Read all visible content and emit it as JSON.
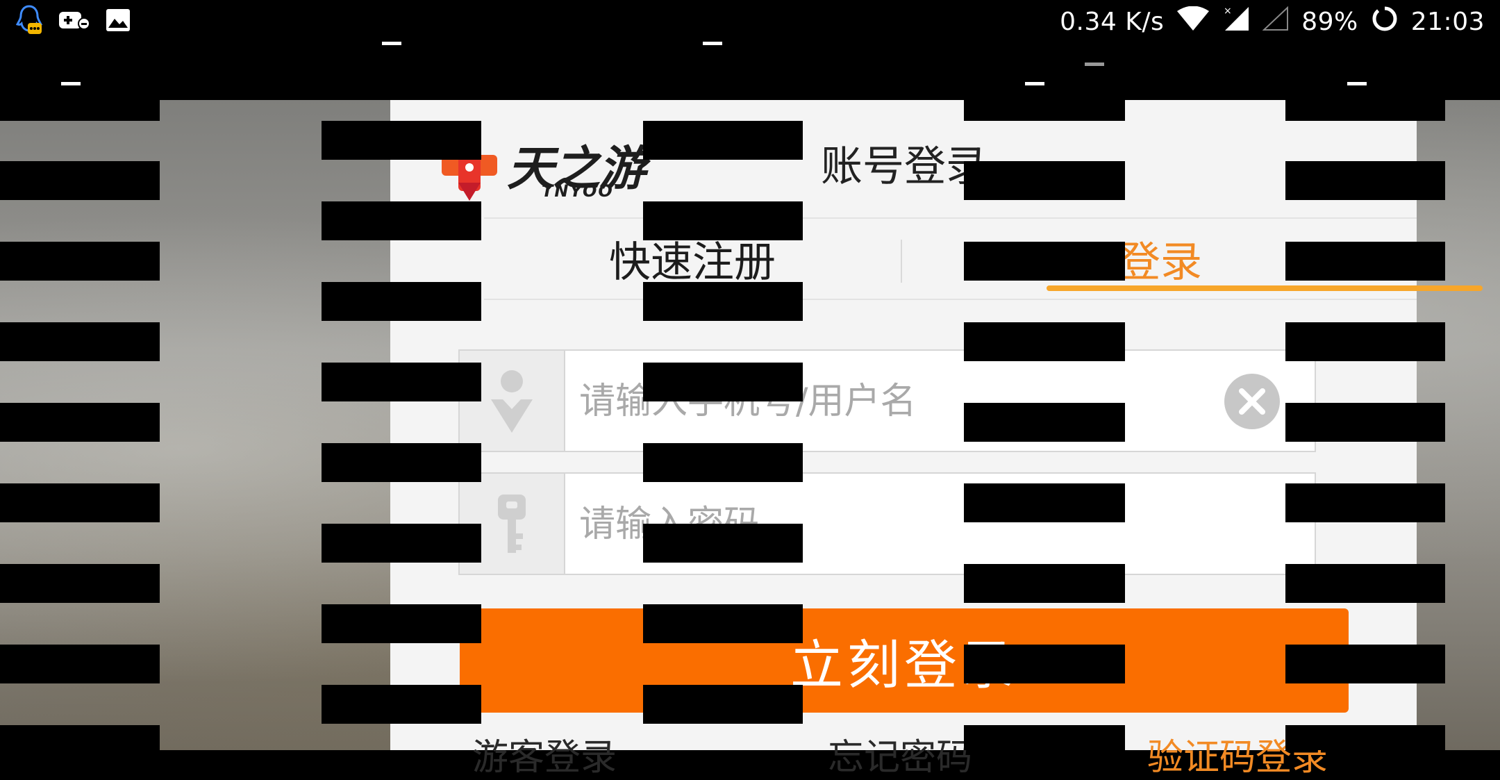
{
  "status_bar": {
    "network_speed": "0.34 K/s",
    "battery": "89%",
    "time": "21:03",
    "left_icons": [
      "qq-icon",
      "game-controller-icon",
      "image-icon"
    ]
  },
  "dialog": {
    "logo_text": "天之游",
    "logo_subtext": "TNYOO",
    "title": "账号登录",
    "tabs": [
      {
        "label": "快速注册",
        "active": false
      },
      {
        "label": "登录",
        "active": true
      }
    ],
    "username_placeholder": "请输入手机号/用户名",
    "password_placeholder": "请输入密码",
    "login_button": "立刻登录",
    "links": {
      "guest": "游客登录",
      "forgot": "忘记密码",
      "sms": "验证码登录"
    }
  },
  "colors": {
    "accent": "#fa6e00",
    "tab_active": "#f28a24",
    "underline": "#f7a62a"
  }
}
